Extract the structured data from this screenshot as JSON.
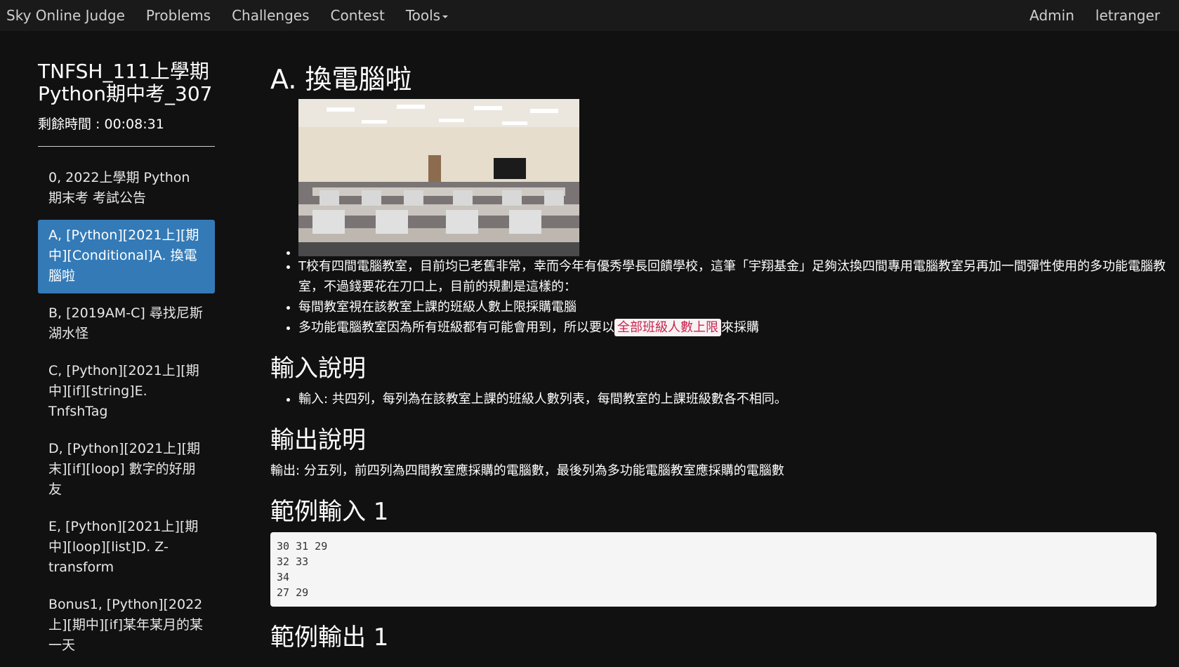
{
  "navbar": {
    "brand": "Sky Online Judge",
    "links": [
      "Problems",
      "Challenges",
      "Contest",
      "Tools"
    ],
    "right": [
      "Admin",
      "letranger"
    ]
  },
  "sidebar": {
    "contest_title_line1": "TNFSH_111上學期",
    "contest_title_line2": "Python期中考_307",
    "timer": "剩餘時間 : 00:08:31",
    "items": [
      "0, 2022上學期 Python 期末考 考試公告",
      "A, [Python][2021上][期中][Conditional]A. 換電腦啦",
      "B, [2019AM-C] 尋找尼斯湖水怪",
      "C, [Python][2021上][期中][if][string]E. TnfshTag",
      "D, [Python][2021上][期末][if][loop] 數字的好朋友",
      "E, [Python][2021上][期中][loop][list]D. Z-transform",
      "Bonus1, [Python][2022上][期中][if]某年某月的某一天"
    ],
    "active_index": 1
  },
  "problem": {
    "title": "A. 換電腦啦",
    "bullets": [
      "T校有四間電腦教室，目前均已老舊非常，幸而今年有優秀學長回饋學校，這筆「宇翔基金」足夠汰換四間專用電腦教室另再加一間彈性使用的多功能電腦教室，不過錢要花在刀口上，目前的規劃是這樣的：",
      "每間教室視在該教室上課的班級人數上限採購電腦"
    ],
    "bullet3_before": "多功能電腦教室因為所有班級都有可能會用到，所以要以",
    "bullet3_highlight": "全部班級人數上限",
    "bullet3_after": "來採購",
    "input_heading": "輸入說明",
    "input_text": "輸入: 共四列，每列為在該教室上課的班級人數列表，每間教室的上課班級數各不相同。",
    "output_heading": "輸出說明",
    "output_text": "輸出: 分五列，前四列為四間教室應採購的電腦數，最後列為多功能電腦教室應採購的電腦數",
    "sample_input_heading": "範例輸入 1",
    "sample_input": "30 31 29\n32 33\n34\n27 29",
    "sample_output_heading": "範例輸出 1"
  }
}
